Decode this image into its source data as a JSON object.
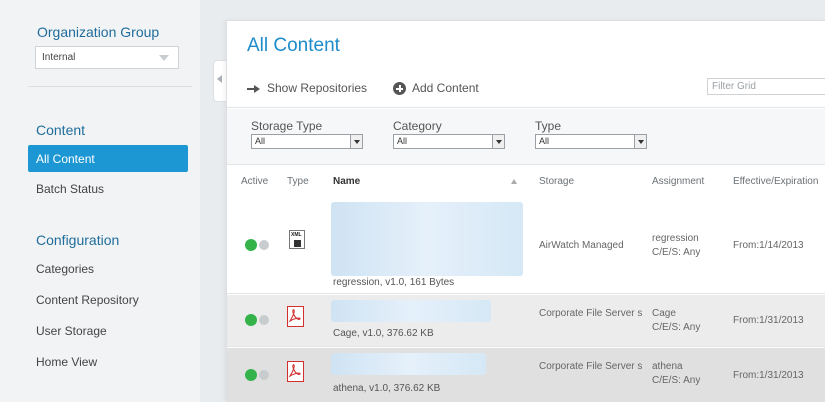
{
  "sidebar": {
    "org_group_title": "Organization Group",
    "org_group_value": "Internal",
    "content_title": "Content",
    "content_items": [
      {
        "label": "All Content",
        "active": true
      },
      {
        "label": "Batch Status",
        "active": false
      }
    ],
    "config_title": "Configuration",
    "config_items": [
      {
        "label": "Categories"
      },
      {
        "label": "Content Repository"
      },
      {
        "label": "User Storage"
      },
      {
        "label": "Home View"
      }
    ]
  },
  "main": {
    "title": "All Content",
    "toolbar": {
      "show_repositories": "Show Repositories",
      "add_content": "Add Content",
      "filter_placeholder": "Filter Grid"
    },
    "filters": [
      {
        "label": "Storage Type",
        "value": "All"
      },
      {
        "label": "Category",
        "value": "All"
      },
      {
        "label": "Type",
        "value": "All"
      }
    ],
    "columns": [
      "Active",
      "Type",
      "Name",
      "Storage",
      "Assignment",
      "Effective/Expiration"
    ],
    "rows": [
      {
        "icon": "xml-file-icon",
        "meta": "regression, v1.0, 161 Bytes",
        "storage": "AirWatch Managed",
        "assignment_1": "regression",
        "assignment_2": "C/E/S: Any",
        "effective": "From:1/14/2013"
      },
      {
        "icon": "pdf-file-icon",
        "meta": "Cage, v1.0, 376.62 KB",
        "storage": "Corporate File Server s",
        "assignment_1": "Cage",
        "assignment_2": "C/E/S: Any",
        "effective": "From:1/31/2013"
      },
      {
        "icon": "pdf-file-icon",
        "meta": "athena, v1.0, 376.62 KB",
        "storage": "Corporate File Server s",
        "assignment_1": "athena",
        "assignment_2": "C/E/S: Any",
        "effective": "From:1/31/2013"
      }
    ]
  },
  "colors": {
    "accent": "#1c97d4",
    "title_blue": "#1f6d9c",
    "active_green": "#33b34a",
    "pdf_red": "#d32f2f"
  }
}
